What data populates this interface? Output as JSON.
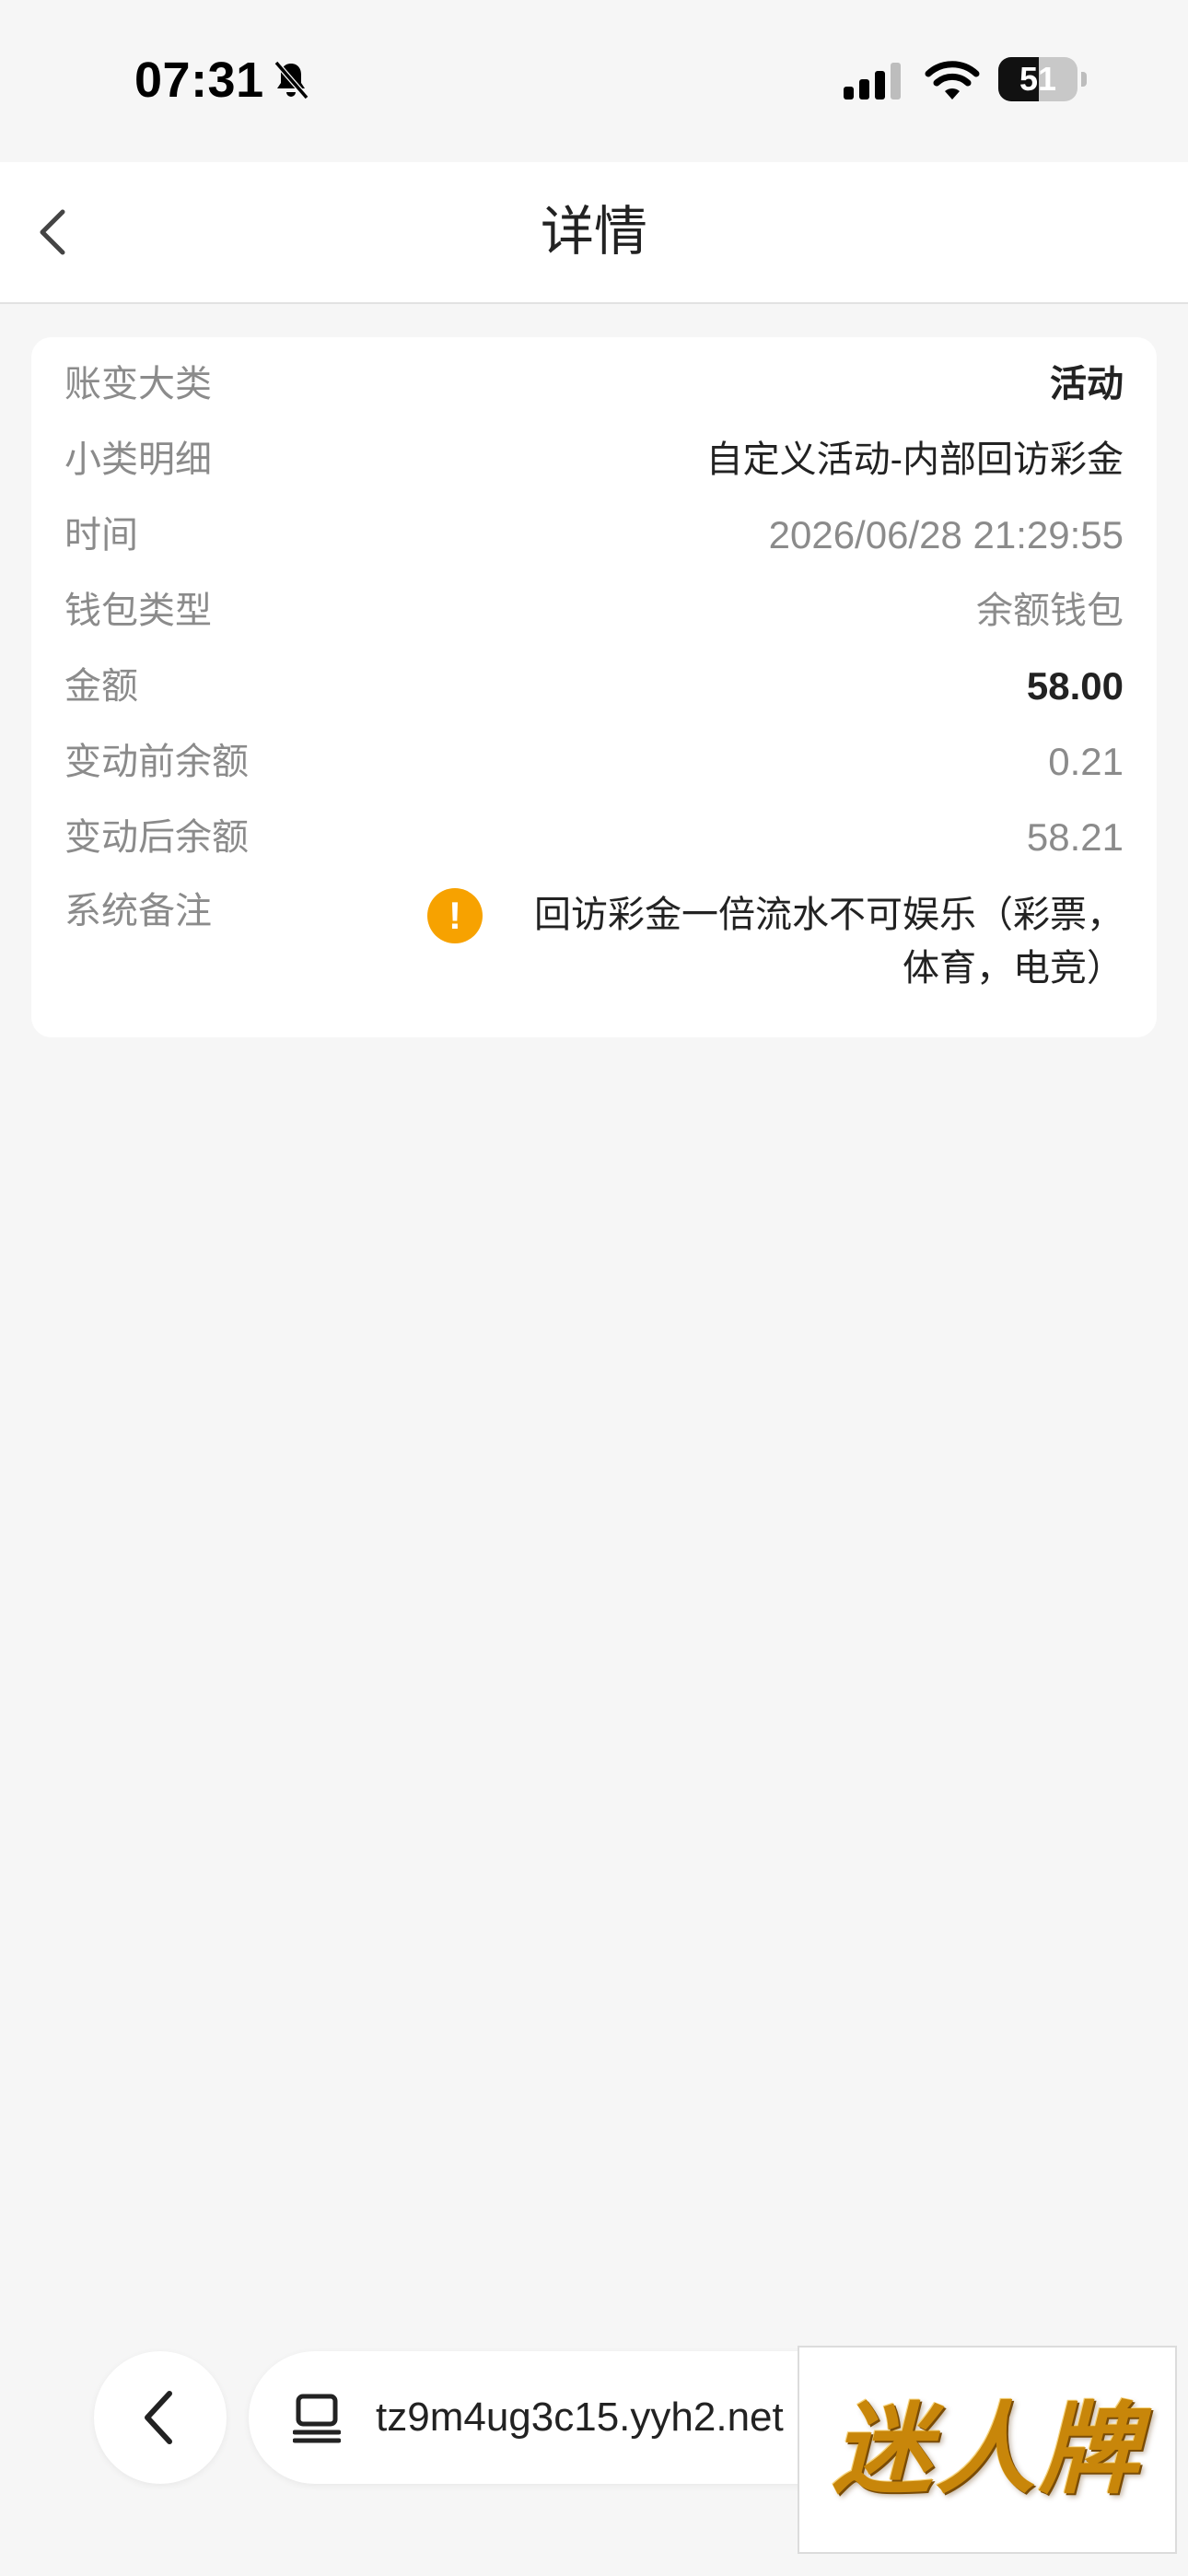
{
  "status_bar": {
    "time": "07:31",
    "battery_level": "51",
    "battery_fraction": 0.51
  },
  "nav": {
    "title": "详情"
  },
  "details": {
    "category_label": "账变大类",
    "category_value": "活动",
    "subcategory_label": "小类明细",
    "subcategory_value": "自定义活动-内部回访彩金",
    "time_label": "时间",
    "time_value": "2026/06/28 21:29:55",
    "wallet_label": "钱包类型",
    "wallet_value": "余额钱包",
    "amount_label": "金额",
    "amount_value": "58.00",
    "balance_before_label": "变动前余额",
    "balance_before_value": "0.21",
    "balance_after_label": "变动后余额",
    "balance_after_value": "58.21",
    "note_label": "系统备注",
    "note_icon": "!",
    "note_value": "回访彩金一倍流水不可娱乐（彩票，体育，电竞）"
  },
  "browser": {
    "url": "tz9m4ug3c15.yyh2.net"
  },
  "watermark": {
    "logo_text": "迷人牌"
  },
  "colors": {
    "accent_warning": "#f7a200",
    "label_gray": "#8b8b8b",
    "text_dark": "#222222",
    "background": "#f6f6f6"
  }
}
